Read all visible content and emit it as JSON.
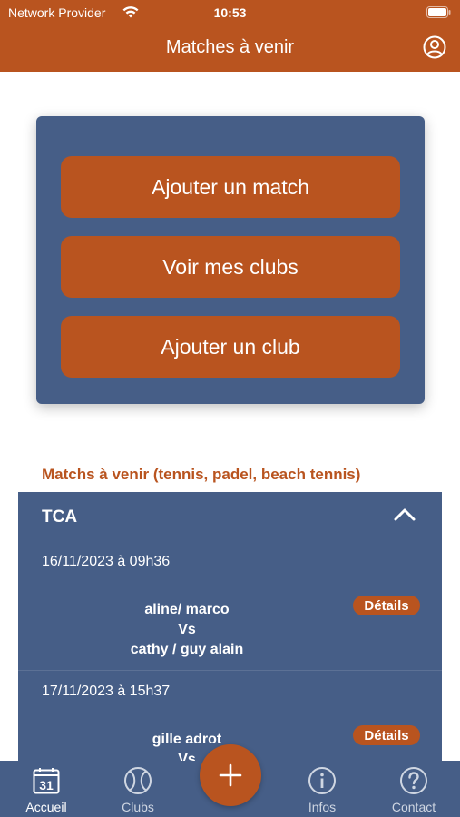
{
  "status_bar": {
    "carrier": "Network Provider",
    "time": "10:53"
  },
  "nav": {
    "title": "Matches à venir"
  },
  "actions": {
    "add_match": "Ajouter un match",
    "my_clubs": "Voir mes clubs",
    "add_club": "Ajouter un club"
  },
  "matches_section": {
    "title": "Matchs à venir (tennis, padel, beach tennis)",
    "club": "TCA",
    "matches": [
      {
        "date": "16/11/2023 à 09h36",
        "team1": "aline/ marco",
        "vs": "Vs",
        "team2": "cathy / guy alain",
        "details_label": "Détails"
      },
      {
        "date": "17/11/2023 à 15h37",
        "team1": "gille adrot",
        "vs": "Vs",
        "details_label": "Détails"
      }
    ]
  },
  "tabbar": {
    "home": "Accueil",
    "clubs": "Clubs",
    "infos": "Infos",
    "contact": "Contact",
    "calendar_day": "31"
  },
  "colors": {
    "accent": "#b9541f",
    "panel": "#465e87"
  }
}
